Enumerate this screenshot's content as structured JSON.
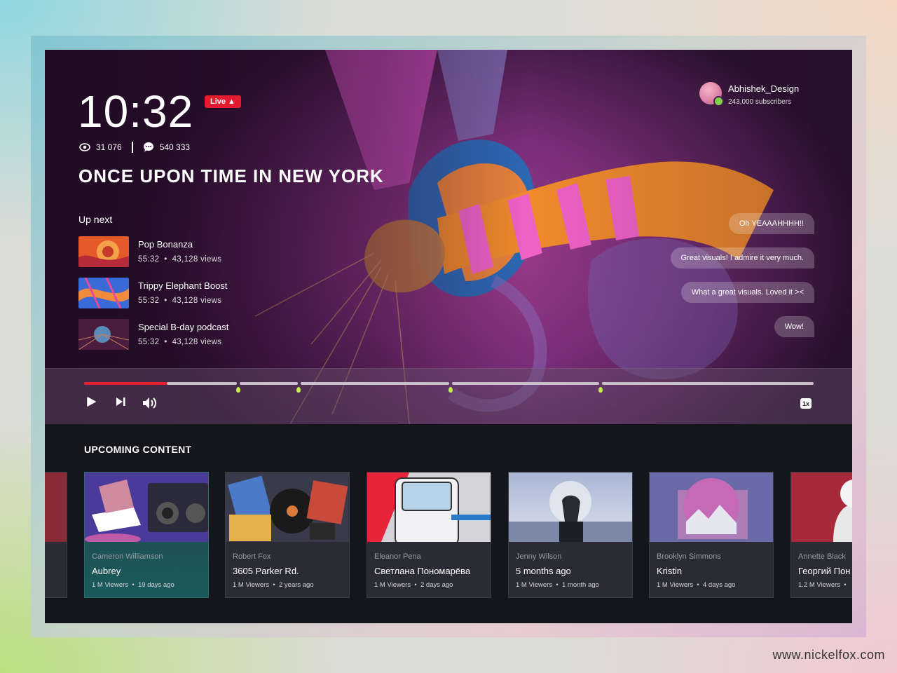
{
  "player": {
    "clock": "10:32",
    "live_label": "Live",
    "views": "31 076",
    "comments": "540 333",
    "title": "ONCE UPON TIME IN NEW YORK",
    "up_next_heading": "Up next",
    "up_next": [
      {
        "title": "Pop Bonanza",
        "duration": "55:32",
        "views": "43,128 views"
      },
      {
        "title": "Trippy Elephant Boost",
        "duration": "55:32",
        "views": "43,128 views"
      },
      {
        "title": "Special B-day podcast",
        "duration": "55:32",
        "views": "43,128 views"
      }
    ],
    "channel": {
      "name": "Abhishek_Design",
      "subscribers": "243,000 subscribers"
    },
    "chat": [
      "Oh YEAAAHHHH!!",
      "Great visuals! I admire it very much.",
      "What a great visuals. Loved it ><",
      "Wow!"
    ],
    "speed": "1x",
    "progress_fraction": 0.112
  },
  "upcoming": {
    "heading": "UPCOMING CONTENT",
    "cards": [
      {
        "author": "Cameron Williamson",
        "title": "Aubrey",
        "viewers": "1 M Viewers",
        "age": "19 days ago"
      },
      {
        "author": "Robert Fox",
        "title": "3605 Parker Rd.",
        "viewers": "1 M Viewers",
        "age": "2 years ago"
      },
      {
        "author": "Eleanor Pena",
        "title": "Светлана Пономарёва",
        "viewers": "1 M Viewers",
        "age": "2 days ago"
      },
      {
        "author": "Jenny Wilson",
        "title": "5 months ago",
        "viewers": "1 M Viewers",
        "age": "1 month ago"
      },
      {
        "author": "Brooklyn Simmons",
        "title": "Kristin",
        "viewers": "1 M Viewers",
        "age": "4 days ago"
      },
      {
        "author": "Annette Black",
        "title": "Георгий Пон",
        "viewers": "1.2 M Viewers",
        "age": ""
      }
    ]
  },
  "footer": {
    "site": "www.nickelfox.com"
  },
  "colors": {
    "live_red": "#e31b2e",
    "progress_red": "#e4202f",
    "marker_green": "#c5f04a",
    "app_bg": "#15161c"
  }
}
